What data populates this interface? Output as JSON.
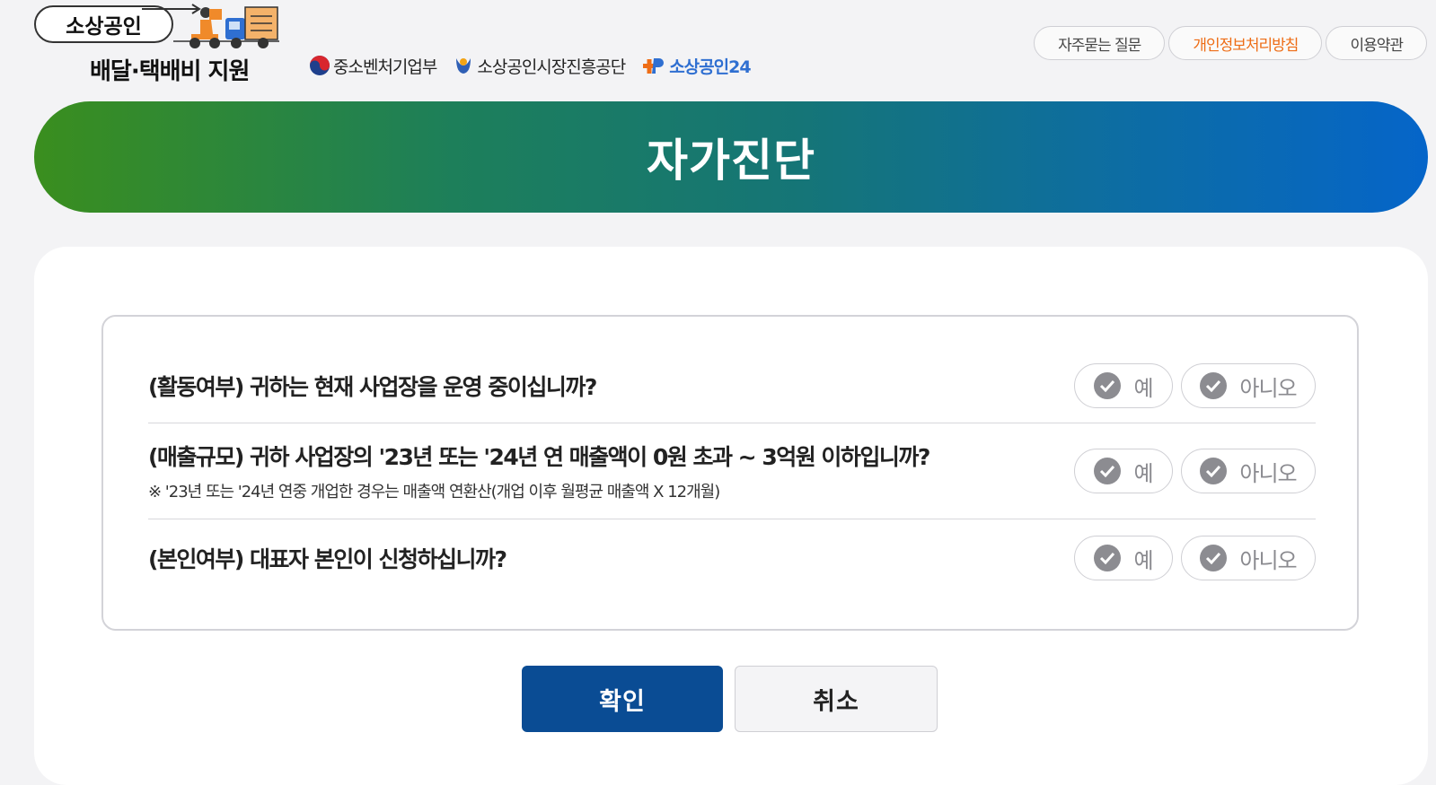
{
  "header": {
    "logo_title": "소상공인",
    "logo_subtitle": "배달·택배비 지원",
    "partners": [
      "중소벤처기업부",
      "소상공인시장진흥공단",
      "소상공인24"
    ],
    "nav": [
      "자주묻는 질문",
      "개인정보처리방침",
      "이용약관"
    ]
  },
  "banner": {
    "title": "자가진단"
  },
  "questions": [
    {
      "label": "(활동여부) 귀하는 현재 사업장을 운영 중이십니까?",
      "note": ""
    },
    {
      "label": "(매출규모) 귀하 사업장의 '23년 또는 '24년 연 매출액이 0원 초과 ~ 3억원 이하입니까?",
      "note": "※ '23년 또는 '24년 연중 개업한 경우는 매출액 연환산(개업 이후 월평균 매출액 X 12개월)"
    },
    {
      "label": "(본인여부) 대표자 본인이 신청하십니까?",
      "note": ""
    }
  ],
  "answers": {
    "yes": "예",
    "no": "아니오"
  },
  "buttons": {
    "confirm": "확인",
    "cancel": "취소"
  },
  "colors": {
    "primary": "#0a4c94",
    "accent_orange": "#ee6d16",
    "gradient_start": "#3a8e1e",
    "gradient_end": "#0565c9"
  },
  "icons": {
    "answer": "check-circle-icon"
  }
}
